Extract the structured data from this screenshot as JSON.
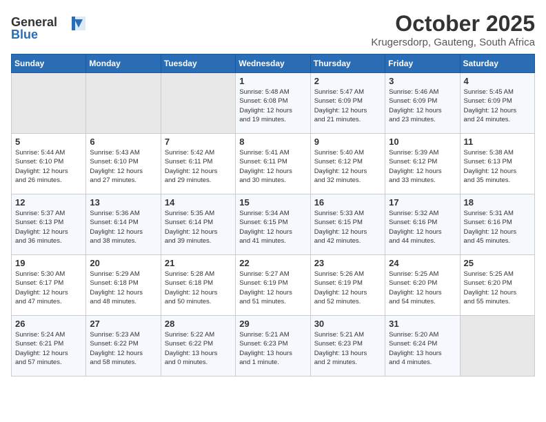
{
  "header": {
    "logo_line1": "General",
    "logo_line2": "Blue",
    "month_year": "October 2025",
    "location": "Krugersdorp, Gauteng, South Africa"
  },
  "days_of_week": [
    "Sunday",
    "Monday",
    "Tuesday",
    "Wednesday",
    "Thursday",
    "Friday",
    "Saturday"
  ],
  "weeks": [
    [
      {
        "day": "",
        "content": ""
      },
      {
        "day": "",
        "content": ""
      },
      {
        "day": "",
        "content": ""
      },
      {
        "day": "1",
        "content": "Sunrise: 5:48 AM\nSunset: 6:08 PM\nDaylight: 12 hours\nand 19 minutes."
      },
      {
        "day": "2",
        "content": "Sunrise: 5:47 AM\nSunset: 6:09 PM\nDaylight: 12 hours\nand 21 minutes."
      },
      {
        "day": "3",
        "content": "Sunrise: 5:46 AM\nSunset: 6:09 PM\nDaylight: 12 hours\nand 23 minutes."
      },
      {
        "day": "4",
        "content": "Sunrise: 5:45 AM\nSunset: 6:09 PM\nDaylight: 12 hours\nand 24 minutes."
      }
    ],
    [
      {
        "day": "5",
        "content": "Sunrise: 5:44 AM\nSunset: 6:10 PM\nDaylight: 12 hours\nand 26 minutes."
      },
      {
        "day": "6",
        "content": "Sunrise: 5:43 AM\nSunset: 6:10 PM\nDaylight: 12 hours\nand 27 minutes."
      },
      {
        "day": "7",
        "content": "Sunrise: 5:42 AM\nSunset: 6:11 PM\nDaylight: 12 hours\nand 29 minutes."
      },
      {
        "day": "8",
        "content": "Sunrise: 5:41 AM\nSunset: 6:11 PM\nDaylight: 12 hours\nand 30 minutes."
      },
      {
        "day": "9",
        "content": "Sunrise: 5:40 AM\nSunset: 6:12 PM\nDaylight: 12 hours\nand 32 minutes."
      },
      {
        "day": "10",
        "content": "Sunrise: 5:39 AM\nSunset: 6:12 PM\nDaylight: 12 hours\nand 33 minutes."
      },
      {
        "day": "11",
        "content": "Sunrise: 5:38 AM\nSunset: 6:13 PM\nDaylight: 12 hours\nand 35 minutes."
      }
    ],
    [
      {
        "day": "12",
        "content": "Sunrise: 5:37 AM\nSunset: 6:13 PM\nDaylight: 12 hours\nand 36 minutes."
      },
      {
        "day": "13",
        "content": "Sunrise: 5:36 AM\nSunset: 6:14 PM\nDaylight: 12 hours\nand 38 minutes."
      },
      {
        "day": "14",
        "content": "Sunrise: 5:35 AM\nSunset: 6:14 PM\nDaylight: 12 hours\nand 39 minutes."
      },
      {
        "day": "15",
        "content": "Sunrise: 5:34 AM\nSunset: 6:15 PM\nDaylight: 12 hours\nand 41 minutes."
      },
      {
        "day": "16",
        "content": "Sunrise: 5:33 AM\nSunset: 6:15 PM\nDaylight: 12 hours\nand 42 minutes."
      },
      {
        "day": "17",
        "content": "Sunrise: 5:32 AM\nSunset: 6:16 PM\nDaylight: 12 hours\nand 44 minutes."
      },
      {
        "day": "18",
        "content": "Sunrise: 5:31 AM\nSunset: 6:16 PM\nDaylight: 12 hours\nand 45 minutes."
      }
    ],
    [
      {
        "day": "19",
        "content": "Sunrise: 5:30 AM\nSunset: 6:17 PM\nDaylight: 12 hours\nand 47 minutes."
      },
      {
        "day": "20",
        "content": "Sunrise: 5:29 AM\nSunset: 6:18 PM\nDaylight: 12 hours\nand 48 minutes."
      },
      {
        "day": "21",
        "content": "Sunrise: 5:28 AM\nSunset: 6:18 PM\nDaylight: 12 hours\nand 50 minutes."
      },
      {
        "day": "22",
        "content": "Sunrise: 5:27 AM\nSunset: 6:19 PM\nDaylight: 12 hours\nand 51 minutes."
      },
      {
        "day": "23",
        "content": "Sunrise: 5:26 AM\nSunset: 6:19 PM\nDaylight: 12 hours\nand 52 minutes."
      },
      {
        "day": "24",
        "content": "Sunrise: 5:25 AM\nSunset: 6:20 PM\nDaylight: 12 hours\nand 54 minutes."
      },
      {
        "day": "25",
        "content": "Sunrise: 5:25 AM\nSunset: 6:20 PM\nDaylight: 12 hours\nand 55 minutes."
      }
    ],
    [
      {
        "day": "26",
        "content": "Sunrise: 5:24 AM\nSunset: 6:21 PM\nDaylight: 12 hours\nand 57 minutes."
      },
      {
        "day": "27",
        "content": "Sunrise: 5:23 AM\nSunset: 6:22 PM\nDaylight: 12 hours\nand 58 minutes."
      },
      {
        "day": "28",
        "content": "Sunrise: 5:22 AM\nSunset: 6:22 PM\nDaylight: 13 hours\nand 0 minutes."
      },
      {
        "day": "29",
        "content": "Sunrise: 5:21 AM\nSunset: 6:23 PM\nDaylight: 13 hours\nand 1 minute."
      },
      {
        "day": "30",
        "content": "Sunrise: 5:21 AM\nSunset: 6:23 PM\nDaylight: 13 hours\nand 2 minutes."
      },
      {
        "day": "31",
        "content": "Sunrise: 5:20 AM\nSunset: 6:24 PM\nDaylight: 13 hours\nand 4 minutes."
      },
      {
        "day": "",
        "content": ""
      }
    ]
  ]
}
